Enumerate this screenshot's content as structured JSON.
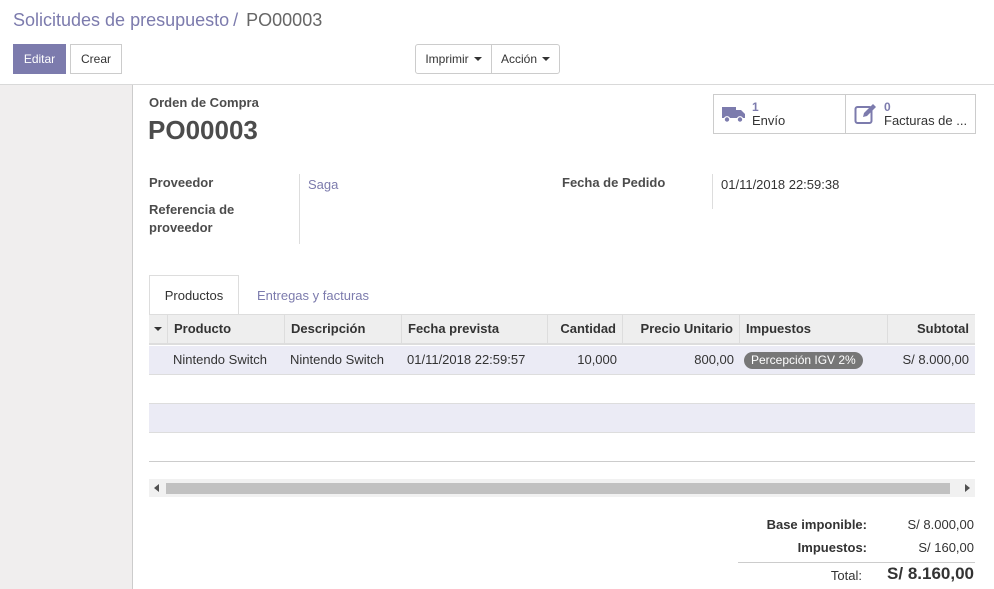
{
  "breadcrumb": {
    "parent": "Solicitudes de presupuesto",
    "separator": "/",
    "current": "PO00003"
  },
  "toolbar": {
    "edit_label": "Editar",
    "create_label": "Crear",
    "print_label": "Imprimir",
    "action_label": "Acción"
  },
  "form": {
    "doc_type": "Orden de Compra",
    "doc_name": "PO00003",
    "smart_buttons": [
      {
        "count": "1",
        "label": "Envío",
        "icon": "truck-icon"
      },
      {
        "count": "0",
        "label": "Facturas de ...",
        "icon": "edit-icon"
      }
    ],
    "fields": {
      "vendor_label": "Proveedor",
      "vendor_value": "Saga",
      "vendor_ref_label_1": "Referencia de",
      "vendor_ref_label_2": "proveedor",
      "order_date_label": "Fecha de Pedido",
      "order_date_value": "01/11/2018 22:59:38"
    },
    "tabs": [
      {
        "label": "Productos",
        "active": true
      },
      {
        "label": "Entregas y facturas",
        "active": false
      }
    ]
  },
  "order_lines": {
    "columns": [
      "Producto",
      "Descripción",
      "Fecha prevista",
      "Cantidad",
      "Precio Unitario",
      "Impuestos",
      "Subtotal"
    ],
    "rows": [
      {
        "product": "Nintendo Switch",
        "description": "Nintendo Switch",
        "date": "01/11/2018 22:59:57",
        "quantity": "10,000",
        "unit_price": "800,00",
        "taxes": "Percepción IGV 2%",
        "subtotal": "S/ 8.000,00"
      }
    ]
  },
  "totals": {
    "untaxed_label": "Base imponible:",
    "untaxed_value": "S/ 8.000,00",
    "taxes_label": "Impuestos:",
    "taxes_value": "S/ 160,00",
    "total_label": "Total:",
    "total_value": "S/ 8.160,00"
  },
  "colors": {
    "brand": "#7c7bad",
    "badge": "#777777",
    "row_highlight": "#ebebf5"
  }
}
